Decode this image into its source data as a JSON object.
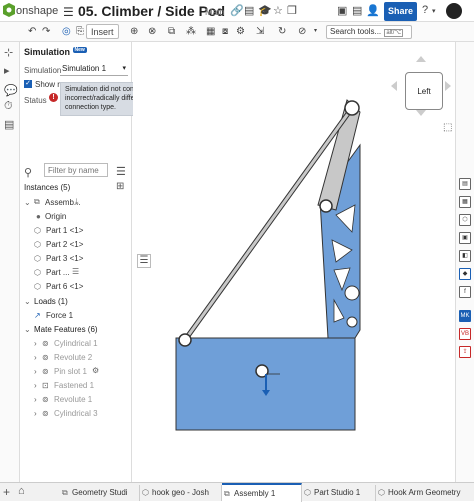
{
  "app": {
    "brand": "onshape",
    "document_title": "05. Climber / Side Pod",
    "branch": "Main"
  },
  "header": {
    "share_label": "Share",
    "help_icon": "?"
  },
  "toolbar": {
    "insert_label": "Insert",
    "search_placeholder": "Search tools...",
    "search_shortcut_1": "alt/⌥",
    "search_shortcut_2": "c"
  },
  "simulation": {
    "title": "Simulation",
    "new_badge": "New",
    "simulation_label": "Simulation",
    "simulation_value": "Simulation 1",
    "show_results_label": "Show res",
    "status_label": "Status",
    "error_message": "Simulation did not converge. Check for rigid body motion, incorrect/radically different material properties, or change the connection type."
  },
  "instances": {
    "filter_placeholder": "Filter by name",
    "header": "Instances (5)",
    "items": [
      {
        "label": "Assemb..."
      },
      {
        "label": "Origin"
      },
      {
        "label": "Part 1 <1>"
      },
      {
        "label": "Part 2 <1>"
      },
      {
        "label": "Part 3 <1>"
      },
      {
        "label": "Part ..."
      },
      {
        "label": "Part 6 <1>"
      }
    ]
  },
  "loads": {
    "header": "Loads (1)",
    "items": [
      {
        "label": "Force 1"
      }
    ]
  },
  "mates": {
    "header": "Mate Features (6)",
    "items": [
      {
        "label": "Cylindrical 1"
      },
      {
        "label": "Revolute 2"
      },
      {
        "label": "Pin slot 1"
      },
      {
        "label": "Fastened 1"
      },
      {
        "label": "Revolute 1"
      },
      {
        "label": "Cylindrical 3"
      }
    ]
  },
  "viewcube": {
    "face_label": "Left"
  },
  "tabs": [
    {
      "label": "Geometry Studi"
    },
    {
      "label": "hook geo - Josh"
    },
    {
      "label": "Assembly 1"
    },
    {
      "label": "Part Studio 1"
    },
    {
      "label": "Hook Arm Geometry"
    }
  ],
  "right_rail": {
    "mk_label": "MK",
    "vb_label": "VB"
  },
  "colors": {
    "accent": "#1a5fb4",
    "part_fill": "#6f9fd8",
    "link_fill": "#c8c8c8",
    "error": "#c62828"
  }
}
